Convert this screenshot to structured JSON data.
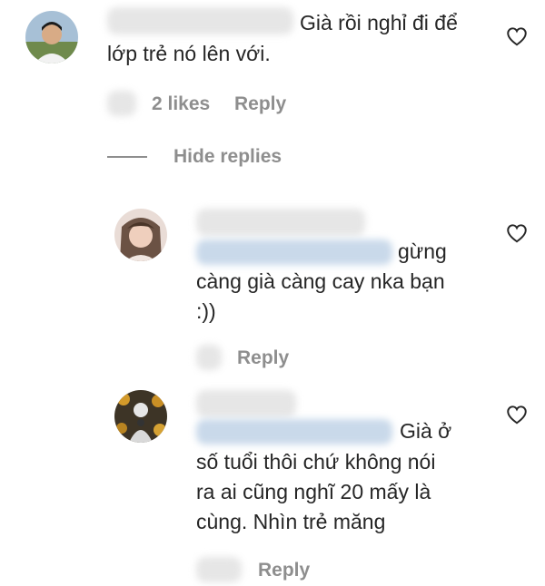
{
  "comments": [
    {
      "text_line1": "Già rồi nghỉ đi để",
      "text_line2": "lớp trẻ nó lên với.",
      "likes": "2 likes",
      "reply": "Reply"
    }
  ],
  "hide_replies": "Hide replies",
  "replies": [
    {
      "text_line1": "gừng",
      "text_line2": "càng già càng cay nka bạn",
      "text_line3": ":))",
      "reply": "Reply"
    },
    {
      "text_line1": "Già ở",
      "text_line2": "số tuổi thôi chứ không nói",
      "text_line3": "ra ai cũng nghĩ 20 mấy là",
      "text_line4": "cùng. Nhìn trẻ măng",
      "reply": "Reply"
    }
  ],
  "icons": {
    "like": "heart-icon"
  },
  "colors": {
    "text": "#262626",
    "secondary": "#8e8e8e",
    "blur_mention": "#c9d9ea"
  }
}
